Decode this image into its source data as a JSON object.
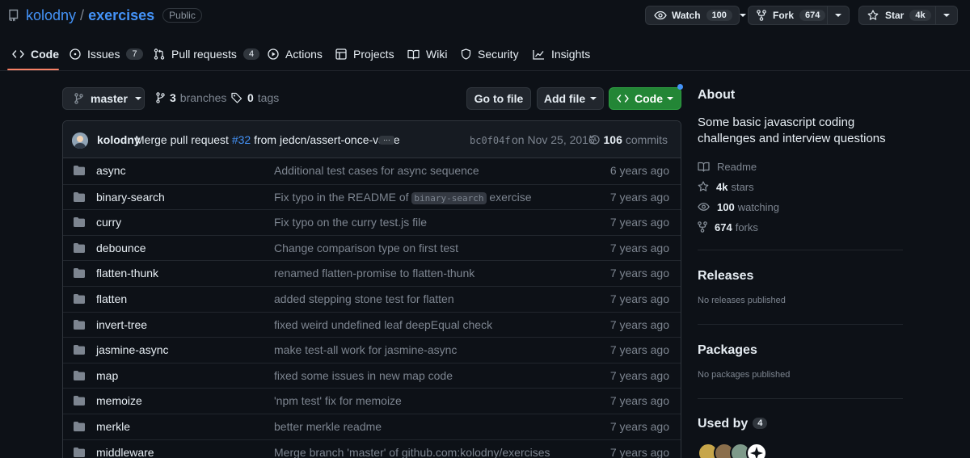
{
  "repo": {
    "owner": "kolodny",
    "name": "exercises",
    "visibility": "Public"
  },
  "header_buttons": {
    "watch": {
      "label": "Watch",
      "count": "100"
    },
    "fork": {
      "label": "Fork",
      "count": "674"
    },
    "star": {
      "label": "Star",
      "count": "4k"
    }
  },
  "tabs": [
    {
      "label": "Code",
      "icon": "code-icon",
      "active": true
    },
    {
      "label": "Issues",
      "icon": "issue-icon",
      "count": "7"
    },
    {
      "label": "Pull requests",
      "icon": "pull-request-icon",
      "count": "4"
    },
    {
      "label": "Actions",
      "icon": "play-icon"
    },
    {
      "label": "Projects",
      "icon": "table-icon"
    },
    {
      "label": "Wiki",
      "icon": "book-icon"
    },
    {
      "label": "Security",
      "icon": "shield-icon"
    },
    {
      "label": "Insights",
      "icon": "graph-icon"
    }
  ],
  "toolbar": {
    "branch": "master",
    "branches_count": "3",
    "branches_label": "branches",
    "tags_count": "0",
    "tags_label": "tags",
    "go_to_file": "Go to file",
    "add_file": "Add file",
    "code": "Code"
  },
  "latest_commit": {
    "author": "kolodny",
    "message_prefix": "Merge pull request",
    "pr": "#32",
    "message_suffix": "from jedcn/assert-once-value",
    "ellipsis": "…",
    "sha": "bc0f04f",
    "date": "on Nov 25, 2016",
    "commits_count": "106",
    "commits_label": "commits"
  },
  "files": [
    {
      "name": "async",
      "msg": "Additional test cases for async sequence",
      "age": "6 years ago"
    },
    {
      "name": "binary-search",
      "msg_before": "Fix typo in the README of",
      "msg_code": "binary-search",
      "msg_after": "exercise",
      "age": "7 years ago"
    },
    {
      "name": "curry",
      "msg": "Fix typo on the curry test.js file",
      "age": "7 years ago"
    },
    {
      "name": "debounce",
      "msg": "Change comparison type on first test",
      "age": "7 years ago"
    },
    {
      "name": "flatten-thunk",
      "msg": "renamed flatten-promise to flatten-thunk",
      "age": "7 years ago"
    },
    {
      "name": "flatten",
      "msg": "added stepping stone test for flatten",
      "age": "7 years ago"
    },
    {
      "name": "invert-tree",
      "msg": "fixed weird undefined leaf deepEqual check",
      "age": "7 years ago"
    },
    {
      "name": "jasmine-async",
      "msg": "make test-all work for jasmine-async",
      "age": "7 years ago"
    },
    {
      "name": "map",
      "msg": "fixed some issues in new map code",
      "age": "7 years ago"
    },
    {
      "name": "memoize",
      "msg": "'npm test' fix for memoize",
      "age": "7 years ago"
    },
    {
      "name": "merkle",
      "msg": "better merkle readme",
      "age": "7 years ago"
    },
    {
      "name": "middleware",
      "msg": "Merge branch 'master' of github.com:kolodny/exercises",
      "age": "7 years ago"
    }
  ],
  "about": {
    "heading": "About",
    "description": "Some basic javascript coding challenges and interview questions",
    "readme": "Readme",
    "stars_count": "4k",
    "stars_label": "stars",
    "watching_count": "100",
    "watching_label": "watching",
    "forks_count": "674",
    "forks_label": "forks"
  },
  "releases": {
    "heading": "Releases",
    "note": "No releases published"
  },
  "packages": {
    "heading": "Packages",
    "note": "No packages published"
  },
  "used_by": {
    "heading": "Used by",
    "count": "4"
  },
  "colors": {
    "accent": "#4493f8",
    "green": "#238636",
    "tab_underline": "#f78166",
    "background": "#0d1117"
  }
}
